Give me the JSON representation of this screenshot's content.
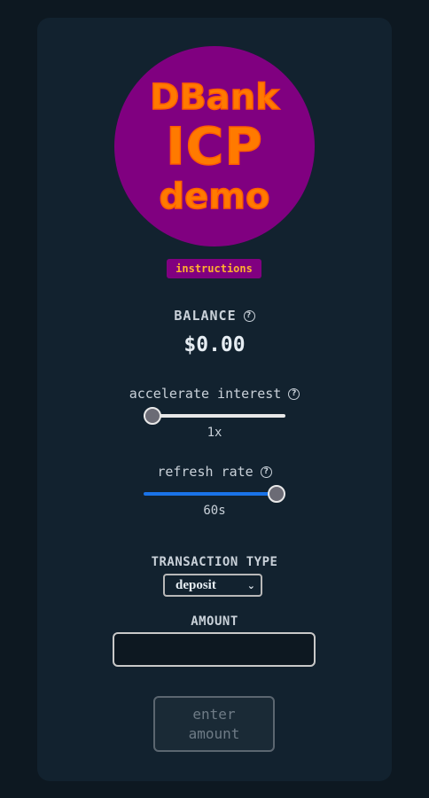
{
  "logo": {
    "line1": "DBank",
    "line2": "ICP",
    "line3": "demo"
  },
  "instructions_label": "instructions",
  "balance": {
    "title": "BALANCE",
    "value": "$0.00"
  },
  "interest": {
    "label": "accelerate interest",
    "value_text": "1x",
    "level_fraction": 0.0
  },
  "refresh": {
    "label": "refresh rate",
    "value_text": "60s",
    "level_fraction": 1.0
  },
  "transaction": {
    "title": "TRANSACTION TYPE",
    "selected": "deposit"
  },
  "amount": {
    "title": "AMOUNT",
    "value": ""
  },
  "submit_label": "enter\namount",
  "colors": {
    "background": "#0d1821",
    "card": "#12222f",
    "logo_bg": "#800080",
    "logo_text": "#ff7a00",
    "slider_active": "#1a73e8"
  },
  "icons": [
    "help-icon",
    "chevron-down-icon"
  ]
}
